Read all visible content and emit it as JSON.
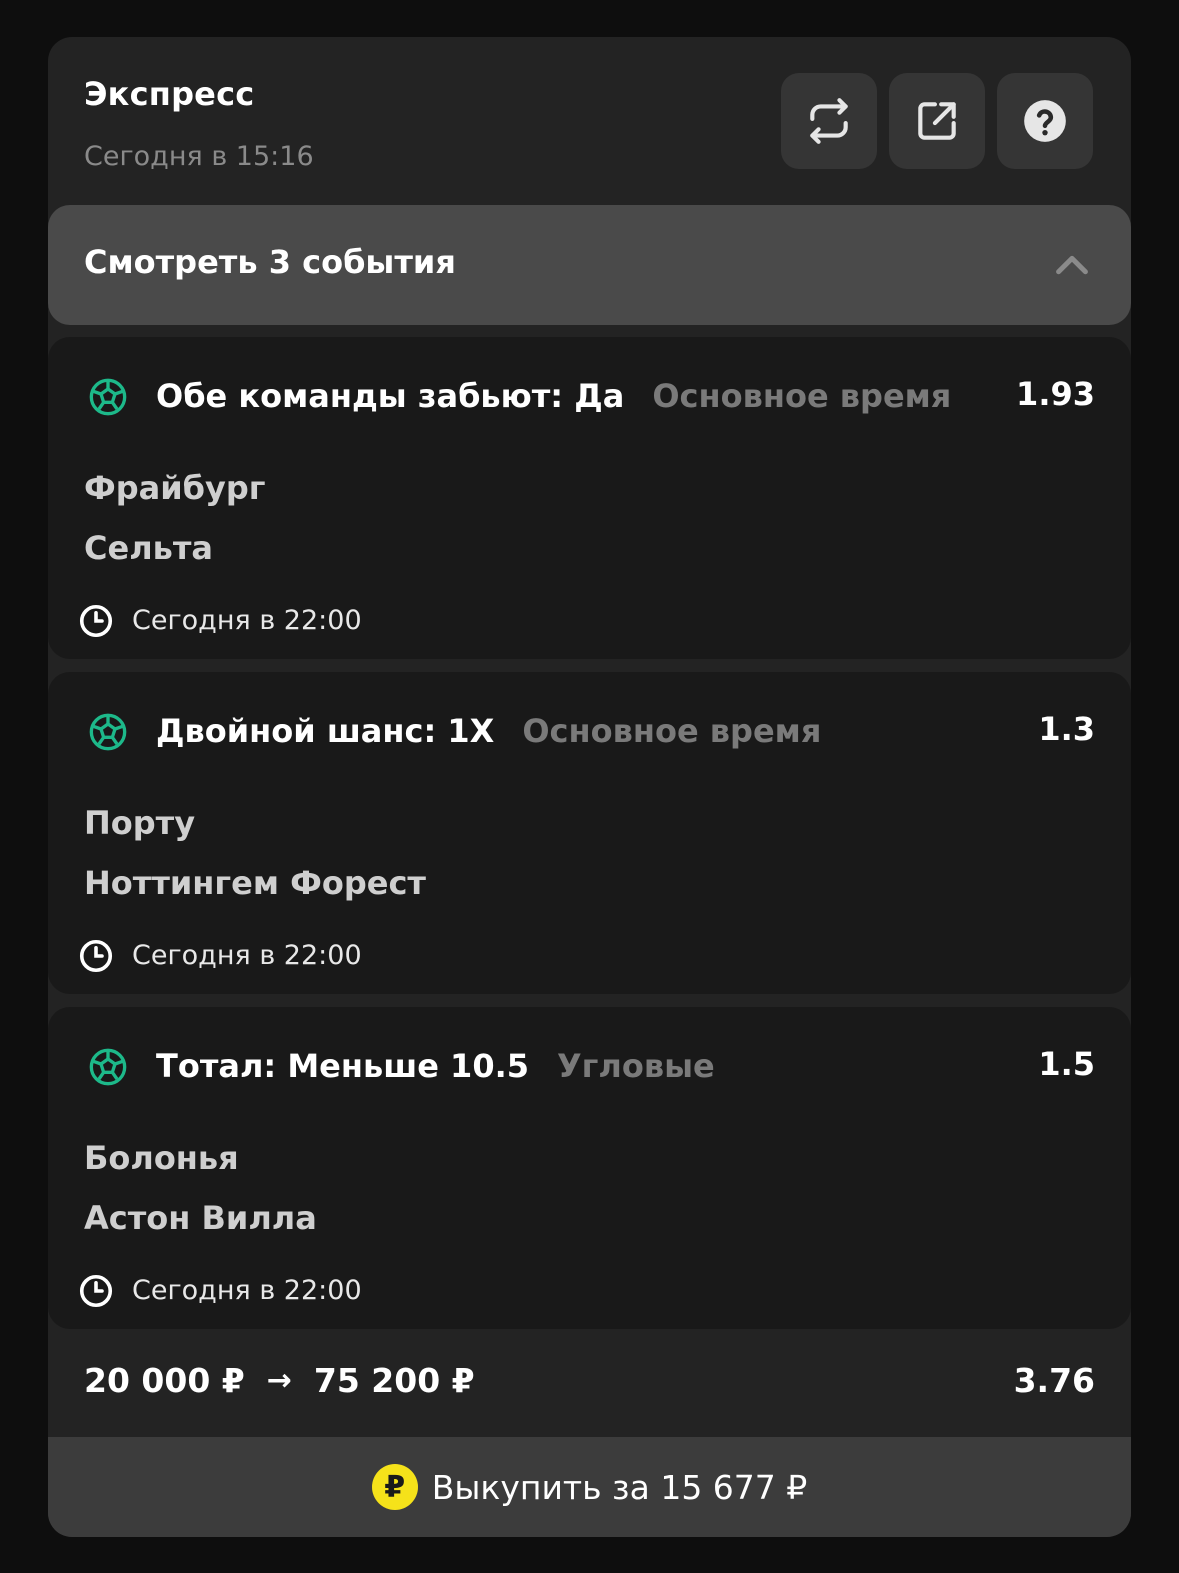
{
  "header": {
    "title": "Экспресс",
    "subtitle": "Сегодня в 15:16"
  },
  "toggle": {
    "label": "Смотреть 3 события"
  },
  "events": [
    {
      "market": "Обе команды забьют: Да",
      "period": "Основное время",
      "odds": "1.93",
      "team1": "Фрайбург",
      "team2": "Сельта",
      "time": "Сегодня в 22:00"
    },
    {
      "market": "Двойной шанс: 1X",
      "period": "Основное время",
      "odds": "1.3",
      "team1": "Порту",
      "team2": "Ноттингем Форест",
      "time": "Сегодня в 22:00"
    },
    {
      "market": "Тотал: Меньше 10.5",
      "period": "Угловые",
      "odds": "1.5",
      "team1": "Болонья",
      "team2": "Астон Вилла",
      "time": "Сегодня в 22:00"
    }
  ],
  "summary": {
    "stake": "20 000 ₽",
    "arrow": "→",
    "payout": "75 200 ₽",
    "total_odds": "3.76"
  },
  "cashout": {
    "coin_symbol": "₽",
    "label": "Выкупить за 15 677 ₽"
  },
  "colors": {
    "background": "#0e0e0e",
    "card": "#232323",
    "event_card": "#191919",
    "toggle_bar": "#4a4a4a",
    "accent_green": "#1db98a",
    "coin_yellow": "#f5e21a",
    "muted_text": "#7a7a7a"
  },
  "icons": {
    "repeat": "repeat-icon",
    "share": "share-icon",
    "help": "help-icon",
    "chevron": "chevron-up-icon",
    "sport": "soccer-ball-icon",
    "time": "clock-icon",
    "coin": "ruble-coin-icon"
  }
}
